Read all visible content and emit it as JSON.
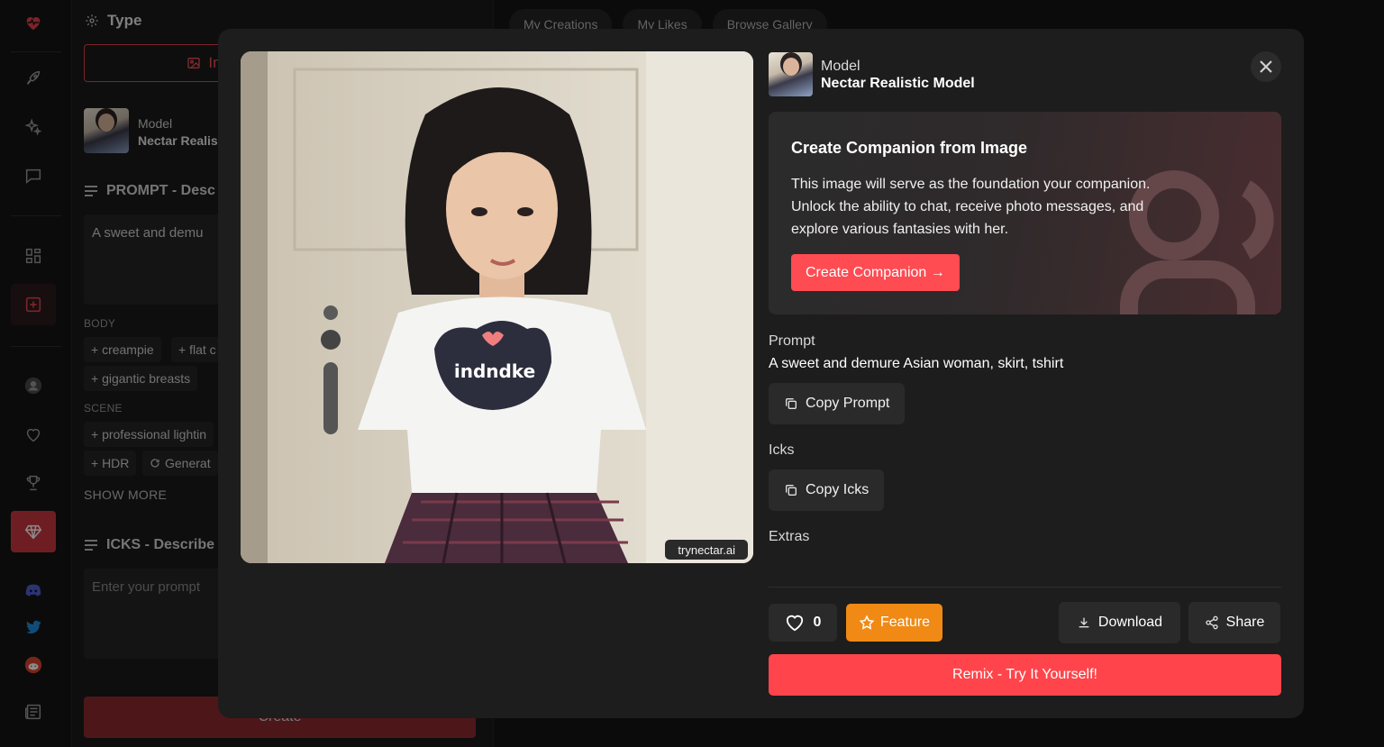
{
  "colors": {
    "brand": "#e0434a",
    "accent_red": "#ff454b",
    "feature": "#f08a14",
    "bg": "#141414",
    "modal": "#1d1d1d"
  },
  "rail": {
    "icons": [
      "heart-logo-icon",
      "rocket-icon",
      "sparkles-icon",
      "chat-icon",
      "grid-icon",
      "add-image-icon",
      "user-icon",
      "heart-icon",
      "trophy-icon",
      "gem-icon",
      "discord-icon",
      "twitter-icon",
      "reddit-icon",
      "news-icon"
    ]
  },
  "panel": {
    "type_title": "Type",
    "type_button": "Image",
    "model_label": "Model",
    "model_value": "Nectar Realis",
    "prompt_section": "PROMPT - Desc",
    "prompt_text": "A sweet and demu",
    "body_label": "BODY",
    "body_chips": [
      "+ creampie",
      "+ flat c",
      "+ gigantic breasts"
    ],
    "scene_label": "SCENE",
    "scene_chips": [
      "+ professional lightin",
      "+ HDR",
      "Generat"
    ],
    "show_more": "SHOW MORE",
    "icks_section": "ICKS - Describe",
    "icks_placeholder": "Enter your prompt",
    "create_label": "Create"
  },
  "tabs": [
    "My Creations",
    "My Likes",
    "Browse Gallery"
  ],
  "modal": {
    "watermark": "trynectar.ai",
    "shirt_text": "indndke",
    "model_label": "Model",
    "model_value": "Nectar Realistic Model",
    "promo": {
      "title": "Create Companion from Image",
      "body": "This image will serve as the foundation your companion. Unlock the ability to chat, receive photo messages, and explore various fantasies with her.",
      "button": "Create Companion →"
    },
    "prompt_label": "Prompt",
    "prompt_value": "A sweet and demure Asian woman, skirt, tshirt",
    "copy_prompt": "Copy Prompt",
    "icks_label": "Icks",
    "copy_icks": "Copy Icks",
    "extras_label": "Extras",
    "like_count": "0",
    "feature": "Feature",
    "download": "Download",
    "share": "Share",
    "remix": "Remix - Try It Yourself!"
  }
}
